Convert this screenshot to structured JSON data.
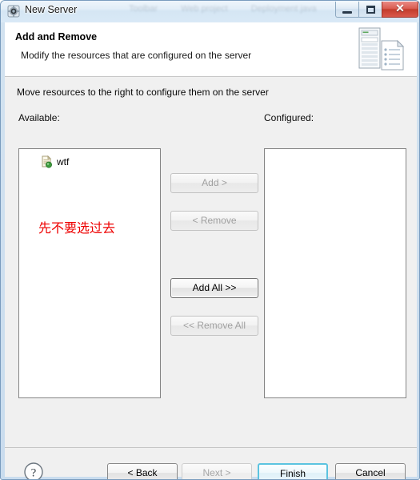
{
  "window": {
    "title": "New Server",
    "title_icon": "server-gear-icon",
    "ghost_tabs": [
      "Toolbar",
      "Web project",
      "Deployment java"
    ],
    "controls": {
      "minimize": "minimize-button",
      "maximize": "maximize-button",
      "close": "close-button",
      "close_glyph": "✕"
    }
  },
  "header": {
    "title": "Add and Remove",
    "description": "Modify the resources that are configured on the server",
    "icon": "server-and-document-icon"
  },
  "main": {
    "intro": "Move resources to the right to configure them on the server",
    "available_label": "Available:",
    "configured_label": "Configured:",
    "available_items": [
      {
        "label": "wtf",
        "icon": "web-module-icon"
      }
    ],
    "configured_items": [],
    "annotation": "先不要选过去",
    "annotation_color": "#ee0000",
    "transfer_buttons": [
      {
        "label": "Add >",
        "enabled": false
      },
      {
        "label": "< Remove",
        "enabled": false
      },
      {
        "label": "Add All >>",
        "enabled": true
      },
      {
        "label": "<< Remove All",
        "enabled": false
      }
    ]
  },
  "footer": {
    "help_icon": "help-question-icon",
    "buttons": [
      {
        "label": "< Back",
        "state": "enabled"
      },
      {
        "label": "Next >",
        "state": "disabled"
      },
      {
        "label": "Finish",
        "state": "default"
      },
      {
        "label": "Cancel",
        "state": "enabled"
      }
    ]
  },
  "colors": {
    "accent": "#5bc3e0",
    "close_red": "#c33c2c",
    "annotation_red": "#ee0000"
  }
}
